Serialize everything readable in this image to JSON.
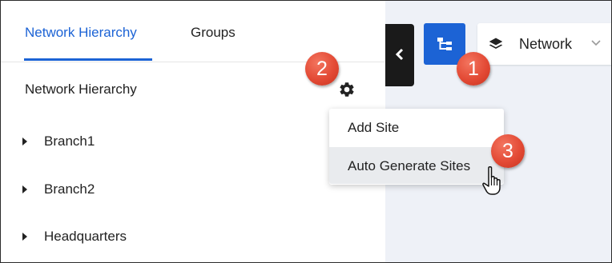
{
  "tabs": [
    {
      "label": "Network Hierarchy",
      "active": true
    },
    {
      "label": "Groups",
      "active": false
    }
  ],
  "panel": {
    "section_title": "Network Hierarchy"
  },
  "tree": [
    {
      "label": "Branch1"
    },
    {
      "label": "Branch2"
    },
    {
      "label": "Headquarters"
    }
  ],
  "toolbar": {
    "network_selector_label": "Network"
  },
  "menu": {
    "items": [
      {
        "label": "Add Site"
      },
      {
        "label": "Auto Generate Sites"
      }
    ]
  },
  "badges": [
    "1",
    "2",
    "3"
  ],
  "icons": {
    "gear": "gear-icon",
    "collapse": "chevron-left-icon",
    "hierarchy": "hierarchy-icon",
    "layers": "layers-icon",
    "dropdown": "chevron-down-icon",
    "cursor": "hand-pointer-icon"
  },
  "colors": {
    "accent": "#1c63d5",
    "badge": "#e34a35",
    "panel_bg": "#eef1f7",
    "collapse_btn": "#1a1a1a"
  }
}
